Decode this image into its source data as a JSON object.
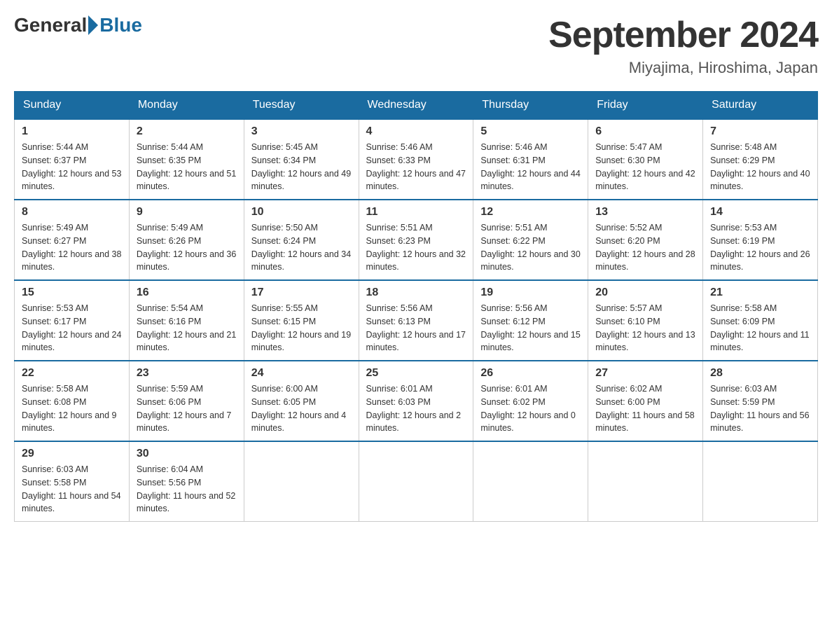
{
  "logo": {
    "general": "General",
    "blue": "Blue"
  },
  "header": {
    "month": "September 2024",
    "location": "Miyajima, Hiroshima, Japan"
  },
  "weekdays": [
    "Sunday",
    "Monday",
    "Tuesday",
    "Wednesday",
    "Thursday",
    "Friday",
    "Saturday"
  ],
  "weeks": [
    [
      {
        "day": "1",
        "sunrise": "5:44 AM",
        "sunset": "6:37 PM",
        "daylight": "12 hours and 53 minutes."
      },
      {
        "day": "2",
        "sunrise": "5:44 AM",
        "sunset": "6:35 PM",
        "daylight": "12 hours and 51 minutes."
      },
      {
        "day": "3",
        "sunrise": "5:45 AM",
        "sunset": "6:34 PM",
        "daylight": "12 hours and 49 minutes."
      },
      {
        "day": "4",
        "sunrise": "5:46 AM",
        "sunset": "6:33 PM",
        "daylight": "12 hours and 47 minutes."
      },
      {
        "day": "5",
        "sunrise": "5:46 AM",
        "sunset": "6:31 PM",
        "daylight": "12 hours and 44 minutes."
      },
      {
        "day": "6",
        "sunrise": "5:47 AM",
        "sunset": "6:30 PM",
        "daylight": "12 hours and 42 minutes."
      },
      {
        "day": "7",
        "sunrise": "5:48 AM",
        "sunset": "6:29 PM",
        "daylight": "12 hours and 40 minutes."
      }
    ],
    [
      {
        "day": "8",
        "sunrise": "5:49 AM",
        "sunset": "6:27 PM",
        "daylight": "12 hours and 38 minutes."
      },
      {
        "day": "9",
        "sunrise": "5:49 AM",
        "sunset": "6:26 PM",
        "daylight": "12 hours and 36 minutes."
      },
      {
        "day": "10",
        "sunrise": "5:50 AM",
        "sunset": "6:24 PM",
        "daylight": "12 hours and 34 minutes."
      },
      {
        "day": "11",
        "sunrise": "5:51 AM",
        "sunset": "6:23 PM",
        "daylight": "12 hours and 32 minutes."
      },
      {
        "day": "12",
        "sunrise": "5:51 AM",
        "sunset": "6:22 PM",
        "daylight": "12 hours and 30 minutes."
      },
      {
        "day": "13",
        "sunrise": "5:52 AM",
        "sunset": "6:20 PM",
        "daylight": "12 hours and 28 minutes."
      },
      {
        "day": "14",
        "sunrise": "5:53 AM",
        "sunset": "6:19 PM",
        "daylight": "12 hours and 26 minutes."
      }
    ],
    [
      {
        "day": "15",
        "sunrise": "5:53 AM",
        "sunset": "6:17 PM",
        "daylight": "12 hours and 24 minutes."
      },
      {
        "day": "16",
        "sunrise": "5:54 AM",
        "sunset": "6:16 PM",
        "daylight": "12 hours and 21 minutes."
      },
      {
        "day": "17",
        "sunrise": "5:55 AM",
        "sunset": "6:15 PM",
        "daylight": "12 hours and 19 minutes."
      },
      {
        "day": "18",
        "sunrise": "5:56 AM",
        "sunset": "6:13 PM",
        "daylight": "12 hours and 17 minutes."
      },
      {
        "day": "19",
        "sunrise": "5:56 AM",
        "sunset": "6:12 PM",
        "daylight": "12 hours and 15 minutes."
      },
      {
        "day": "20",
        "sunrise": "5:57 AM",
        "sunset": "6:10 PM",
        "daylight": "12 hours and 13 minutes."
      },
      {
        "day": "21",
        "sunrise": "5:58 AM",
        "sunset": "6:09 PM",
        "daylight": "12 hours and 11 minutes."
      }
    ],
    [
      {
        "day": "22",
        "sunrise": "5:58 AM",
        "sunset": "6:08 PM",
        "daylight": "12 hours and 9 minutes."
      },
      {
        "day": "23",
        "sunrise": "5:59 AM",
        "sunset": "6:06 PM",
        "daylight": "12 hours and 7 minutes."
      },
      {
        "day": "24",
        "sunrise": "6:00 AM",
        "sunset": "6:05 PM",
        "daylight": "12 hours and 4 minutes."
      },
      {
        "day": "25",
        "sunrise": "6:01 AM",
        "sunset": "6:03 PM",
        "daylight": "12 hours and 2 minutes."
      },
      {
        "day": "26",
        "sunrise": "6:01 AM",
        "sunset": "6:02 PM",
        "daylight": "12 hours and 0 minutes."
      },
      {
        "day": "27",
        "sunrise": "6:02 AM",
        "sunset": "6:00 PM",
        "daylight": "11 hours and 58 minutes."
      },
      {
        "day": "28",
        "sunrise": "6:03 AM",
        "sunset": "5:59 PM",
        "daylight": "11 hours and 56 minutes."
      }
    ],
    [
      {
        "day": "29",
        "sunrise": "6:03 AM",
        "sunset": "5:58 PM",
        "daylight": "11 hours and 54 minutes."
      },
      {
        "day": "30",
        "sunrise": "6:04 AM",
        "sunset": "5:56 PM",
        "daylight": "11 hours and 52 minutes."
      },
      null,
      null,
      null,
      null,
      null
    ]
  ]
}
